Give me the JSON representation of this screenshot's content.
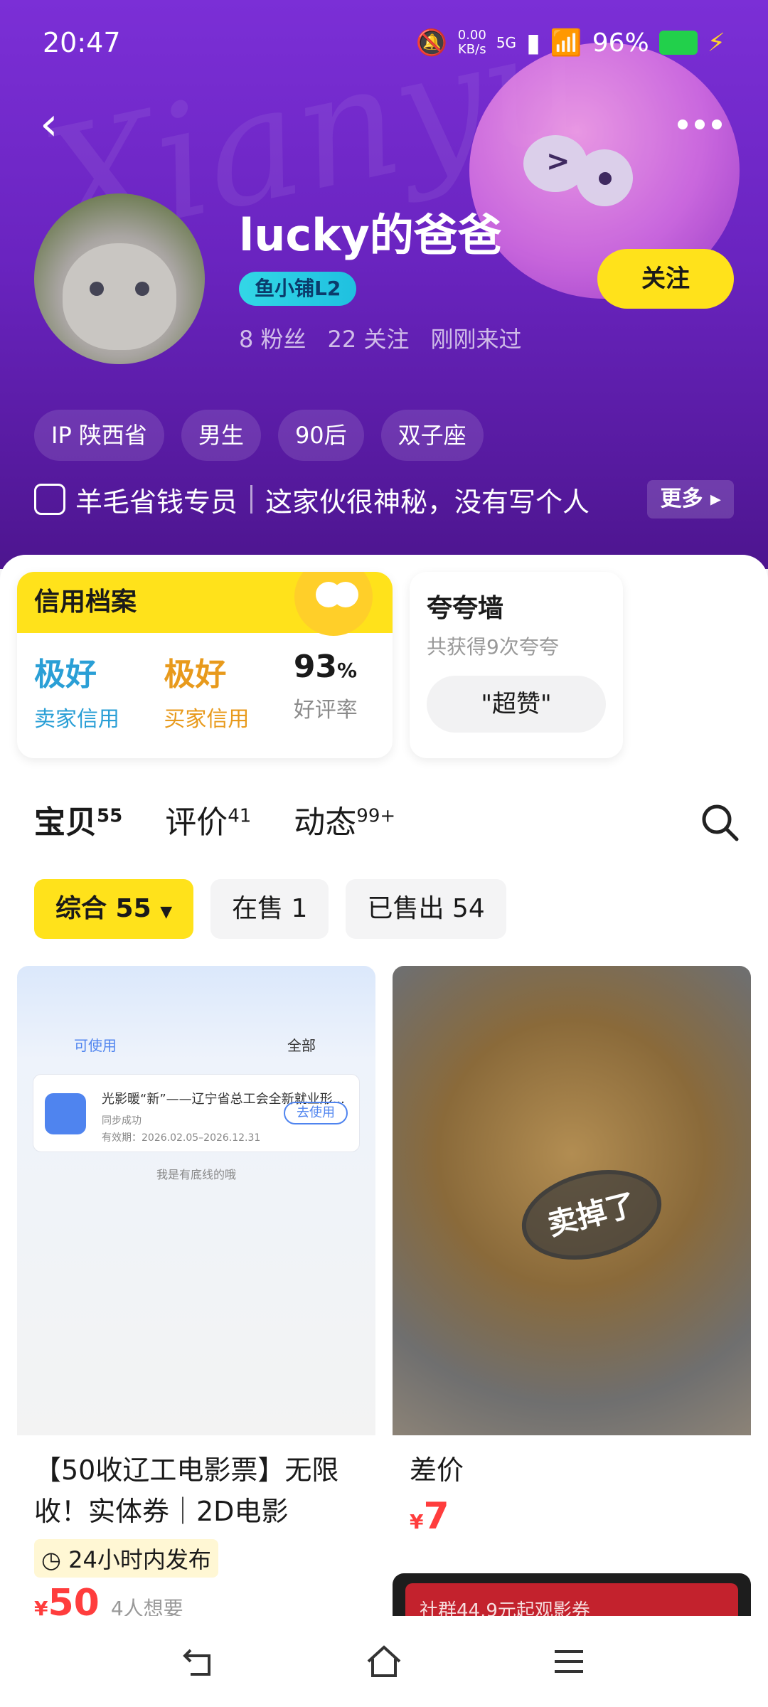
{
  "status_bar": {
    "time": "20:47",
    "net_speed_value": "0.00",
    "net_speed_unit": "KB/s",
    "network": "5G",
    "battery": "96%"
  },
  "header": {
    "watermark": "Xianyu",
    "username": "lucky的爸爸",
    "shop_badge": "鱼小铺L2",
    "fans": "8 粉丝",
    "following": "22 关注",
    "last_seen": "刚刚来过",
    "follow_label": "关注",
    "tags": [
      "IP 陕西省",
      "男生",
      "90后",
      "双子座"
    ],
    "bio_title": "羊毛省钱专员",
    "bio_text": "这家伙很神秘，没有写个人",
    "bio_more": "更多"
  },
  "credit": {
    "title": "信用档案",
    "seller_value": "极好",
    "seller_label": "卖家信用",
    "buyer_value": "极好",
    "buyer_label": "买家信用",
    "rate_value": "93",
    "rate_unit": "%",
    "rate_label": "好评率"
  },
  "praise": {
    "title": "夸夸墙",
    "subtitle": "共获得9次夸夸",
    "chip": "\"超赞\""
  },
  "tabs": [
    {
      "label": "宝贝",
      "count": "55"
    },
    {
      "label": "评价",
      "count": "41"
    },
    {
      "label": "动态",
      "count": "99+"
    }
  ],
  "filters": [
    "综合 55",
    "在售 1",
    "已售出 54"
  ],
  "items": {
    "left": {
      "thumb_tab_a": "可使用",
      "thumb_tab_b": "全部",
      "ticket_title": "光影暖“新”——辽宁省总工会全新就业形...",
      "ticket_status": "同步成功",
      "ticket_validity": "有效期：2026.02.05–2026.12.31",
      "ticket_button": "去使用",
      "thumb_footer": "我是有底线的哦",
      "title": "【50收辽工电影票】无限收！实体券｜2D电影",
      "time_chip": "24小时内发布",
      "price_symbol": "¥",
      "price": "50",
      "want": "4人想要"
    },
    "right": {
      "stamp": "卖掉了",
      "title": "差价",
      "price_symbol": "¥",
      "price": "7",
      "promo_text": "社群44.9元起观影券"
    }
  },
  "colors": {
    "header_top": "#7b2fd6",
    "accent_yellow": "#ffe21b",
    "price_red": "#ff3d3d",
    "seller_blue": "#2a9fd6",
    "buyer_orange": "#e89a1c"
  }
}
